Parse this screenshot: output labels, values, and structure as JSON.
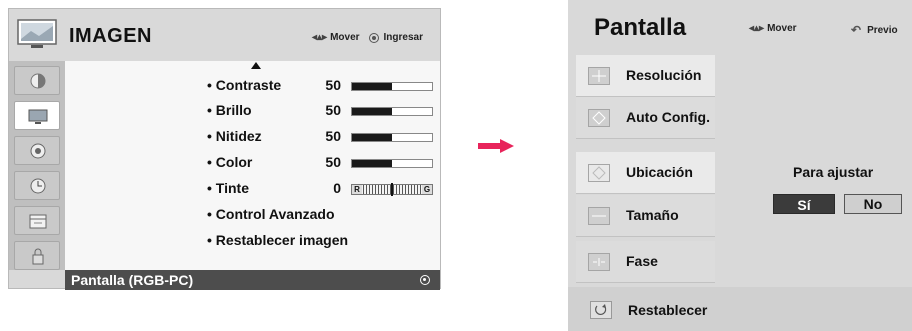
{
  "imagen_menu": {
    "title": "IMAGEN",
    "hint_move": "Mover",
    "hint_enter": "Ingresar",
    "items": [
      {
        "label": "• Contraste",
        "value": "50",
        "level": 0.5
      },
      {
        "label": "• Brillo",
        "value": "50",
        "level": 0.5
      },
      {
        "label": "• Nitidez",
        "value": "50",
        "level": 0.5
      },
      {
        "label": "• Color",
        "value": "50",
        "level": 0.5
      },
      {
        "label": "• Tinte",
        "value": "0",
        "tint_left": "R",
        "tint_right": "G"
      },
      {
        "label": "• Control Avanzado"
      },
      {
        "label": "• Restablecer imagen"
      }
    ],
    "footer_label": "Pantalla (RGB-PC)",
    "sidebar_icons": [
      "picture-icon",
      "tv-screen-icon",
      "speaker-icon",
      "clock-icon",
      "calendar-icon",
      "lock-icon"
    ],
    "active_sidebar_index": 1
  },
  "pantalla_menu": {
    "title": "Pantalla",
    "hint_move": "Mover",
    "hint_prev": "Previo",
    "items": [
      {
        "label": "Resolución",
        "icon": "resolution-icon"
      },
      {
        "label": "Auto Config.",
        "icon": "auto-config-icon"
      },
      {
        "label": "Ubicación",
        "icon": "position-icon"
      },
      {
        "label": "Tamaño",
        "icon": "size-icon"
      },
      {
        "label": "Fase",
        "icon": "phase-icon"
      }
    ],
    "reset_label": "Restablecer",
    "prompt": "Para ajustar",
    "yes_label": "Sí",
    "no_label": "No"
  },
  "colors": {
    "panel_bg": "#d9d9d9",
    "footer_bg": "#4d4d4d",
    "arrow": "#e8245b"
  }
}
